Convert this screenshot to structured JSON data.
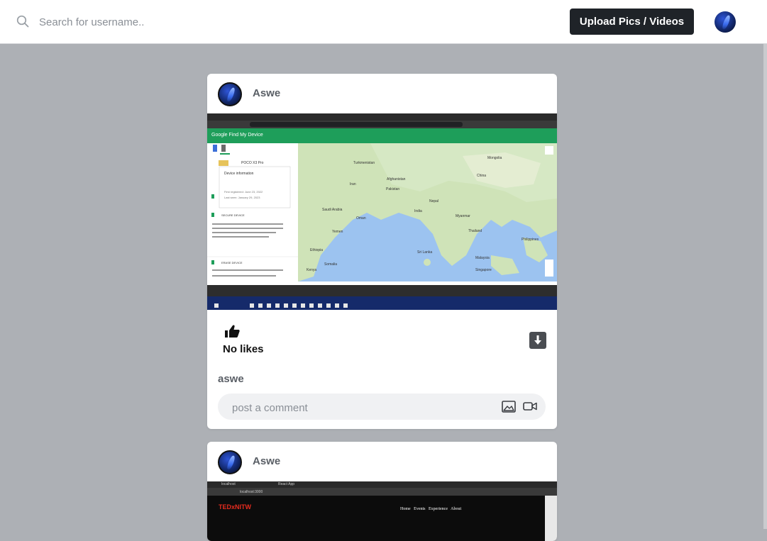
{
  "search": {
    "placeholder": "Search for username.."
  },
  "header": {
    "upload_label": "Upload Pics / Videos"
  },
  "posts": [
    {
      "username": "Aswe",
      "likes_text": "No likes",
      "caption": "aswe",
      "comment_placeholder": "post a comment",
      "screenshot": {
        "app_title": "Google Find My Device",
        "device_name": "POCO X3 Pro",
        "info_title": "Device information",
        "info_first": "First registered: June 23, 2022",
        "info_last": "Last seen: January 29, 2023",
        "secure_title": "SECURE DEVICE",
        "erase_title": "ERASE DEVICE",
        "map_labels": [
          "Afghanistan",
          "Pakistan",
          "Iran",
          "India",
          "China",
          "Mongolia",
          "Thailand",
          "Myanmar",
          "Oman",
          "Yemen",
          "Saudi Arabia",
          "Ethiopia",
          "Kenya",
          "Somalia",
          "Sri Lanka",
          "Philippines",
          "Malaysia",
          "Singapore",
          "Nepal",
          "Turkmenistan"
        ]
      }
    },
    {
      "username": "Aswe",
      "screenshot": {
        "tab1": "localhost",
        "tab2": "React App",
        "url": "localhost:3000",
        "brand": "TEDxNITW",
        "nav": [
          "Home",
          "Events",
          "Experience",
          "About"
        ]
      }
    }
  ],
  "colors": {
    "upload_bg": "#1f2328",
    "page_bg": "#adb0b5",
    "card_bg": "#ffffff"
  }
}
